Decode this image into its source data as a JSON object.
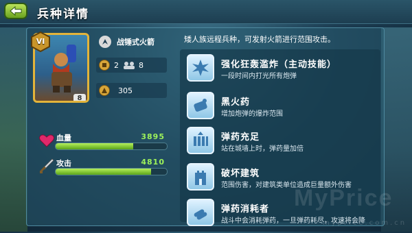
{
  "header": {
    "title": "兵种详情"
  },
  "unit": {
    "card_level": "8",
    "rank_badge": "VI",
    "type_label": "战锤式火箭",
    "cost_gold": "2",
    "housing": "8",
    "damage": "305"
  },
  "bars": {
    "health": {
      "label": "血量",
      "value": "3895",
      "fill": 0.7
    },
    "attack": {
      "label": "攻击",
      "value": "4810",
      "fill": 0.86
    }
  },
  "description": "矮人族远程兵种，可发射火箭进行范围攻击。",
  "skills": [
    {
      "name": "强化狂轰滥炸（主动技能）",
      "desc": "一段时间内打光所有炮弹",
      "icon": "explosion-icon"
    },
    {
      "name": "黑火药",
      "desc": "增加炮弹的爆炸范围",
      "icon": "gunpowder-icon"
    },
    {
      "name": "弹药充足",
      "desc": "站在城墙上时，弹药量加倍",
      "icon": "ammo-rack-icon"
    },
    {
      "name": "破坏建筑",
      "desc": "范围伤害，对建筑类单位造成巨量额外伤害",
      "icon": "tower-icon"
    },
    {
      "name": "弹药消耗者",
      "desc": "战斗中会消耗弹药，一旦弹药耗尽，攻速将会降",
      "icon": "shells-icon"
    }
  ],
  "watermark": {
    "brand": "MyPrice",
    "url": "myprice.com.cn"
  },
  "colors": {
    "accent_green": "#9ef25a",
    "card_border": "#e3b43a"
  }
}
